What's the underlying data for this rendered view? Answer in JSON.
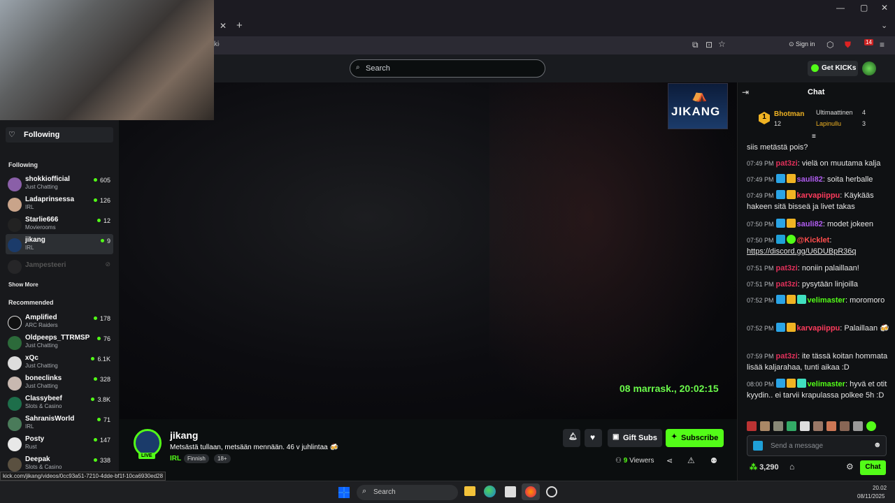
{
  "browser": {
    "address": "kick.com/jikang",
    "sign_in": "Sign in",
    "ext_badge": "14"
  },
  "header": {
    "search_placeholder": "Search",
    "get_kicks": "Get KICKs"
  },
  "sidebar": {
    "following_title": "Following",
    "following_header": "Following",
    "following": [
      {
        "name": "shokkiofficial",
        "category": "Just Chatting",
        "viewers": "605"
      },
      {
        "name": "Ladaprinsessa",
        "category": "IRL",
        "viewers": "126"
      },
      {
        "name": "Starlie666",
        "category": "Movierooms",
        "viewers": "12"
      },
      {
        "name": "jikang",
        "category": "IRL",
        "viewers": "9"
      }
    ],
    "offline": "Jampesteeri",
    "show_more": "Show More",
    "recommended_header": "Recommended",
    "recommended": [
      {
        "name": "Amplified",
        "category": "ARC Raiders",
        "viewers": "178"
      },
      {
        "name": "Oldpeeps_TTRMSP",
        "category": "Just Chatting",
        "viewers": "76"
      },
      {
        "name": "xQc",
        "category": "Just Chatting",
        "viewers": "6.1K"
      },
      {
        "name": "boneclinks",
        "category": "Just Chatting",
        "viewers": "328"
      },
      {
        "name": "Classybeef",
        "category": "Slots & Casino",
        "viewers": "3.8K"
      },
      {
        "name": "SahranisWorld",
        "category": "IRL",
        "viewers": "71"
      },
      {
        "name": "Posty",
        "category": "Rust",
        "viewers": "147"
      },
      {
        "name": "Deepak",
        "category": "Slots & Casino",
        "viewers": "338"
      }
    ]
  },
  "video": {
    "logo_text": "JIKANG",
    "timestamp": "08 marrask., 20:02:15"
  },
  "stream": {
    "channel": "jikang",
    "live": "LIVE",
    "title": "Metsästä tullaan, metsään mennään. 46 v juhlintaa 🍻",
    "category": "IRL",
    "tags": [
      "Finnish",
      "18+"
    ],
    "gift_subs": "Gift Subs",
    "subscribe": "Subscribe",
    "viewers_count": "9",
    "viewers_label": "Viewers"
  },
  "chat": {
    "title": "Chat",
    "leaderboard": {
      "first": {
        "rank": "1",
        "name": "Bhotman",
        "count": "12"
      },
      "second": {
        "name": "Ultimaattinen",
        "count": "4"
      },
      "third": {
        "name": "Lapinullu",
        "count": "3"
      }
    },
    "messages": [
      {
        "time": "",
        "user": "",
        "text": "siis metästä pois?"
      },
      {
        "time": "07:49 PM",
        "user": "pat3zi",
        "text": "vielä on muutama kalja"
      },
      {
        "time": "07:49 PM",
        "user": "sauli82",
        "text": "soita herballe"
      },
      {
        "time": "07:49 PM",
        "user": "karvapiippu",
        "text": "Käykääs hakeen sitä bisseä ja livet takas"
      },
      {
        "time": "07:50 PM",
        "user": "sauli82",
        "text": "modet jokeen"
      },
      {
        "time": "07:50 PM",
        "user": "@Kicklet",
        "text": "https://discord.gg/U6DUBpR36q"
      },
      {
        "time": "07:51 PM",
        "user": "pat3zi",
        "text": "noniin palaillaan!"
      },
      {
        "time": "07:51 PM",
        "user": "pat3zi",
        "text": "pysytään linjoilla"
      },
      {
        "time": "07:52 PM",
        "user": "velimaster",
        "text": "moromoro"
      },
      {
        "time": "07:52 PM",
        "user": "karvapiippu",
        "text": "Palaillaan 🍻"
      },
      {
        "time": "07:59 PM",
        "user": "pat3zi",
        "text": "ite tässä koitan hommata lisää kaljarahaa, tunti aikaa :D"
      },
      {
        "time": "08:00 PM",
        "user": "velimaster",
        "text": "hyvä et otit kyydin.. ei tarvii krapulassa polkee 5h :D"
      }
    ],
    "input_placeholder": "Send a message",
    "points": "3,290",
    "send_label": "Chat"
  },
  "statusbar": {
    "url": "kick.com/jikang/videos/0cc93a51-7210-4dde-bf1f-10ca6930ed28"
  },
  "taskbar": {
    "search_placeholder": "Search",
    "time": "20.02",
    "date": "08/11/2025"
  },
  "colors": {
    "accent": "#53fc18",
    "pat3zi": "#e0305a",
    "sauli82": "#b05cf0",
    "karvapiippu": "#ff3b5c",
    "velimaster": "#53fc18",
    "kicklet": "#ff4d4d"
  }
}
